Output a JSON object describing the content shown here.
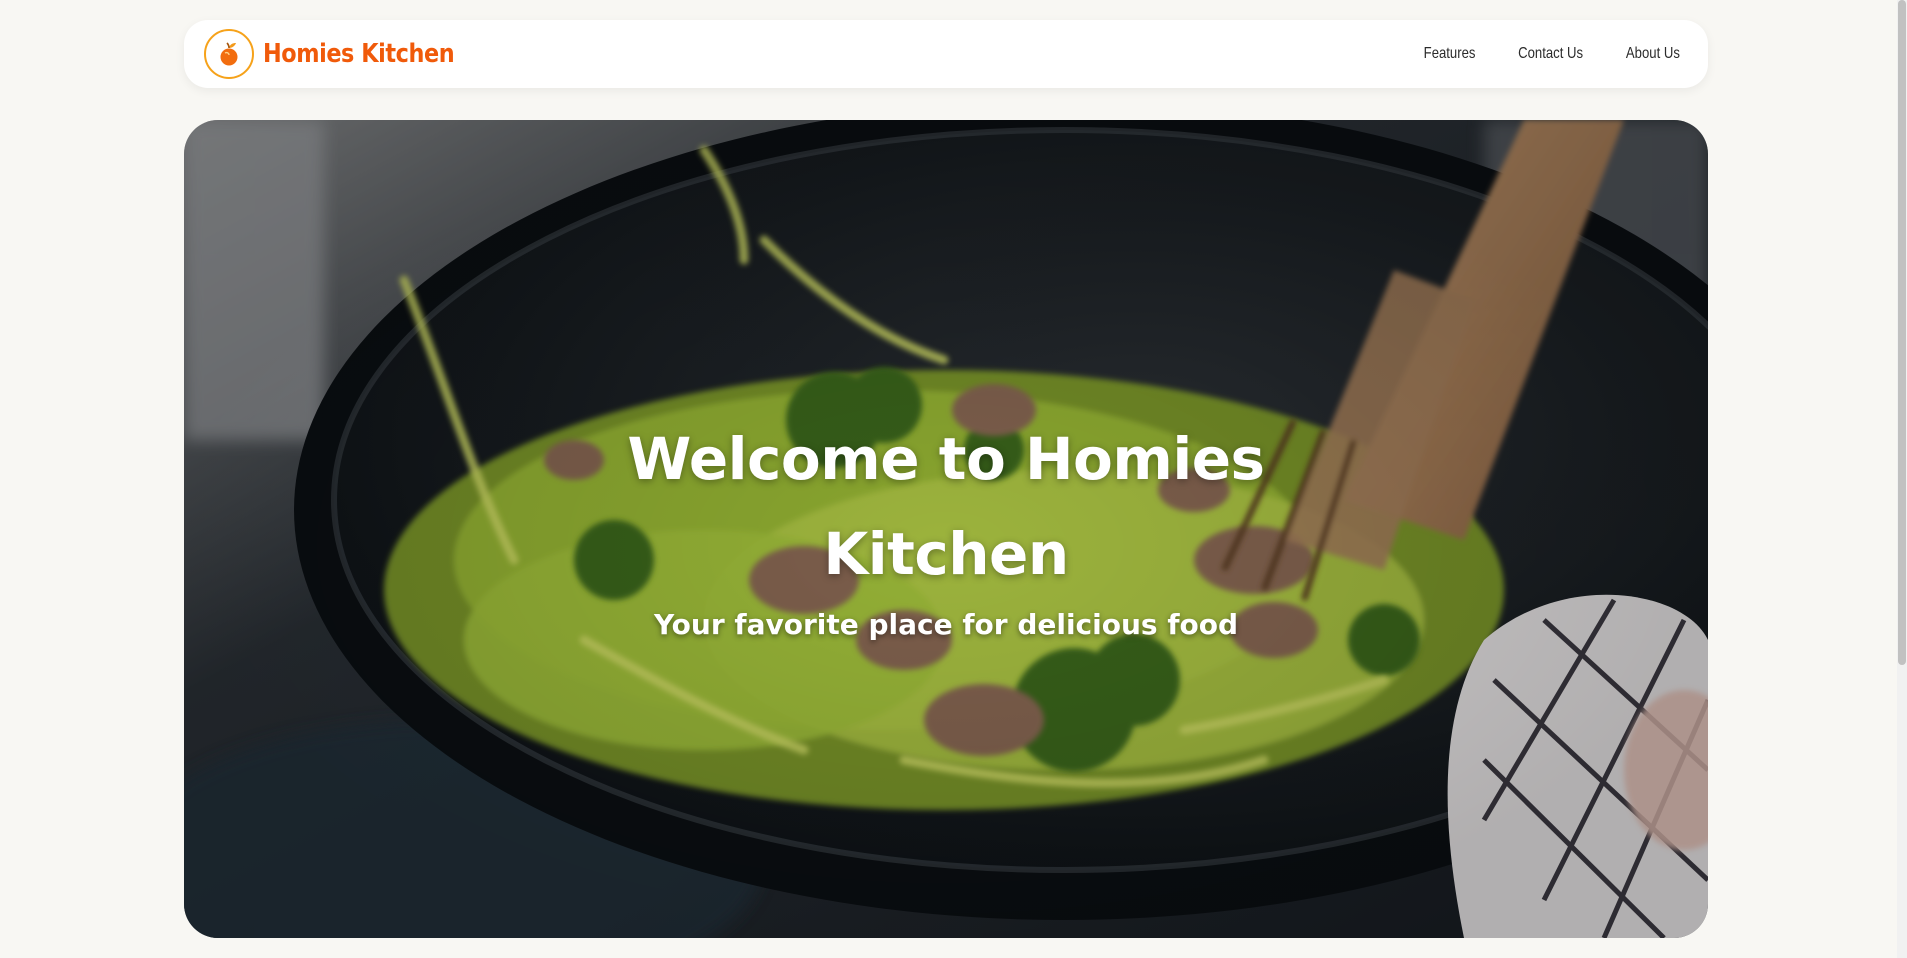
{
  "brand": {
    "name": "Homies Kitchen",
    "logo_icon": "peach-icon",
    "color": "#f05a0a",
    "logo_ring_color": "#f6a21a"
  },
  "nav": {
    "items": [
      {
        "label": "Features"
      },
      {
        "label": "Contact Us"
      },
      {
        "label": "About Us"
      }
    ]
  },
  "hero": {
    "title": "Welcome to Homies Kitchen",
    "subtitle": "Your favorite place for delicious food",
    "background_image": "wok-stir-fry-photo"
  },
  "colors": {
    "page_background": "#f8f7f3",
    "navbar_background": "#ffffff",
    "hero_text": "#ffffff"
  }
}
